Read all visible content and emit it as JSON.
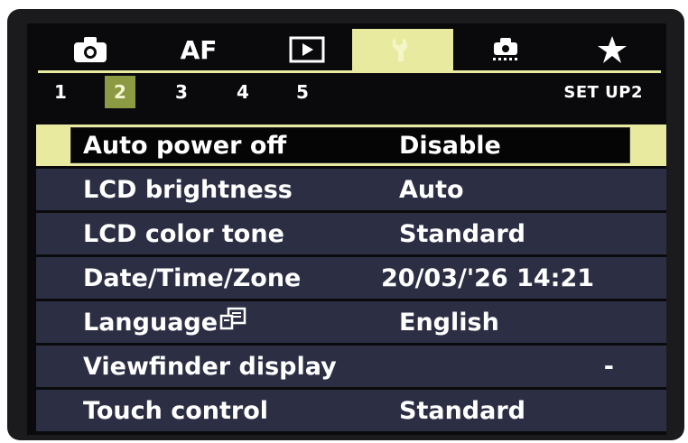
{
  "tabs": [
    {
      "name": "camera-icon",
      "label": ""
    },
    {
      "name": "af-tab",
      "label": "AF"
    },
    {
      "name": "playback-icon",
      "label": ""
    },
    {
      "name": "wrench-icon",
      "label": ""
    },
    {
      "name": "custom-function-icon",
      "label": ""
    },
    {
      "name": "star-icon",
      "label": ""
    }
  ],
  "active_tab": 3,
  "pages": [
    "1",
    "2",
    "3",
    "4",
    "5"
  ],
  "active_page": 1,
  "section_label": "SET UP2",
  "menu": [
    {
      "label": "Auto power off",
      "value": "Disable"
    },
    {
      "label": "LCD brightness",
      "value": "Auto"
    },
    {
      "label": "LCD color tone",
      "value": "Standard"
    },
    {
      "label": "Date/Time/Zone",
      "value": "20/03/'26 14:21"
    },
    {
      "label": "Language",
      "value": "English"
    },
    {
      "label": "Viewfinder display",
      "value": "-"
    },
    {
      "label": "Touch control",
      "value": "Standard"
    }
  ],
  "selected_row": 0,
  "colors": {
    "accent": "#e8eaa0",
    "page_active": "#8c9a44",
    "row_bg": "#2c2f44"
  }
}
